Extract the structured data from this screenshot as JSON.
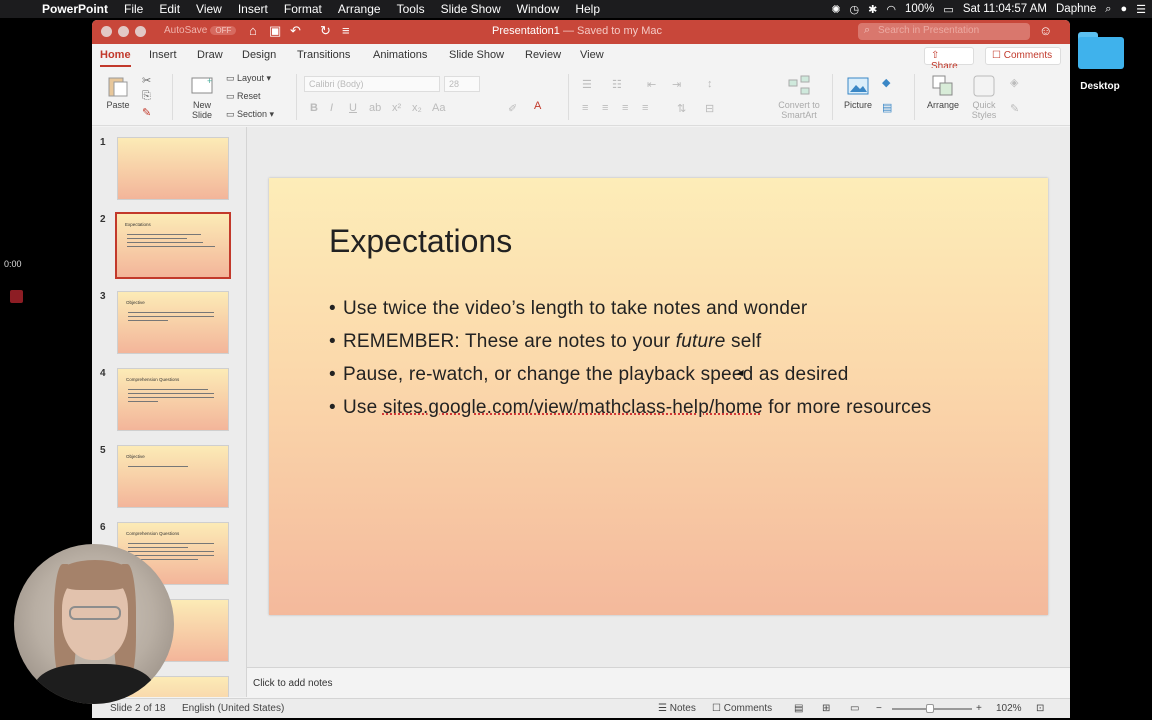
{
  "menubar": {
    "app_name": "PowerPoint",
    "items": [
      "File",
      "Edit",
      "View",
      "Insert",
      "Format",
      "Arrange",
      "Tools",
      "Slide Show",
      "Window",
      "Help"
    ],
    "battery": "100%",
    "clock": "Sat 11:04:57 AM",
    "user": "Daphne"
  },
  "desktop": {
    "folder_label": "Desktop",
    "timer": "0:00"
  },
  "titlebar": {
    "autosave_label": "AutoSave",
    "autosave_state": "OFF",
    "doc_name": "Presentation1",
    "save_status": "— Saved to my Mac",
    "search_placeholder": "Search in Presentation"
  },
  "ribbon_tabs": {
    "tabs": [
      "Home",
      "Insert",
      "Draw",
      "Design",
      "Transitions",
      "Animations",
      "Slide Show",
      "Review",
      "View"
    ],
    "active": "Home",
    "share_label": "Share",
    "comments_label": "Comments"
  },
  "ribbon": {
    "paste": "Paste",
    "new_slide": "New Slide",
    "layout": "Layout",
    "reset": "Reset",
    "section": "Section",
    "font_name": "Calibri (Body)",
    "font_size": "28",
    "convert_smartart": "Convert to SmartArt",
    "picture": "Picture",
    "arrange": "Arrange",
    "quick_styles": "Quick Styles"
  },
  "thumbnails": [
    {
      "num": "1",
      "title": ""
    },
    {
      "num": "2",
      "title": "Expectations"
    },
    {
      "num": "3",
      "title": "Objective"
    },
    {
      "num": "4",
      "title": "Comprehension Questions"
    },
    {
      "num": "5",
      "title": "Objective"
    },
    {
      "num": "6",
      "title": "Comprehension Questions"
    }
  ],
  "slide": {
    "title": "Expectations",
    "bullets": [
      {
        "text": "Use twice the video’s length to take notes and wonder"
      },
      {
        "pre": "REMEMBER: These are notes to your ",
        "em": "future",
        "post": " self"
      },
      {
        "text": "Pause, re-watch, or change the playback speed as desired"
      },
      {
        "pre": "Use ",
        "link": "sites.google.com/view/mathclass-help/home",
        "post": " for more resources"
      }
    ]
  },
  "notes": {
    "placeholder": "Click to add notes"
  },
  "statusbar": {
    "slide_position": "Slide 2 of 18",
    "language": "English (United States)",
    "notes_label": "Notes",
    "comments_label": "Comments",
    "zoom": "102%"
  }
}
